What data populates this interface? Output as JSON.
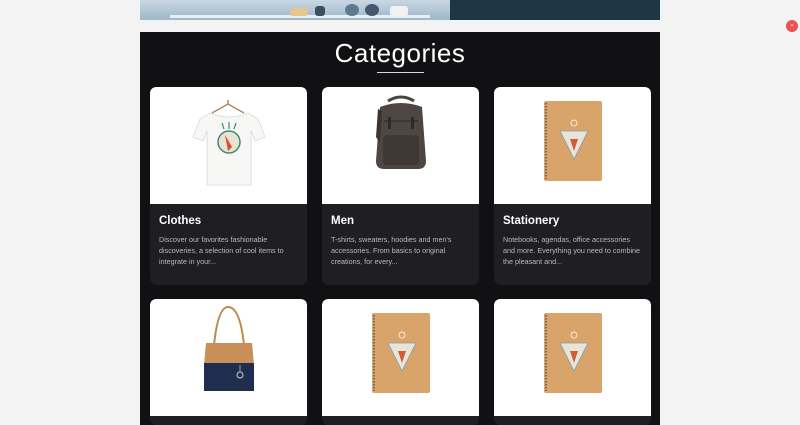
{
  "section": {
    "title": "Categories"
  },
  "fab": {
    "label": "-",
    "color": "#ea5454"
  },
  "cards": [
    {
      "name": "Clothes",
      "image": "t-shirt-image",
      "description": "Discover our favorites fashionable discoveries, a selection of cool items to integrate in your..."
    },
    {
      "name": "Men",
      "image": "backpack-image",
      "description": "T-shirts, sweaters, hoodies and men's accessories. From basics to original creations, for every..."
    },
    {
      "name": "Stationery",
      "image": "notebook-image",
      "description": "Notebooks, agendas, office accessories and more. Everything you need to combine the pleasant and..."
    },
    {
      "name": "",
      "image": "tote-bag-image",
      "description": ""
    },
    {
      "name": "",
      "image": "notebook-image",
      "description": ""
    },
    {
      "name": "",
      "image": "notebook-image",
      "description": ""
    }
  ],
  "colors": {
    "page_background": "#f3f3f3",
    "section_background": "#111114",
    "card_background": "#1e1e23",
    "title_text": "#ffffff",
    "description_text": "#b8b8be"
  }
}
